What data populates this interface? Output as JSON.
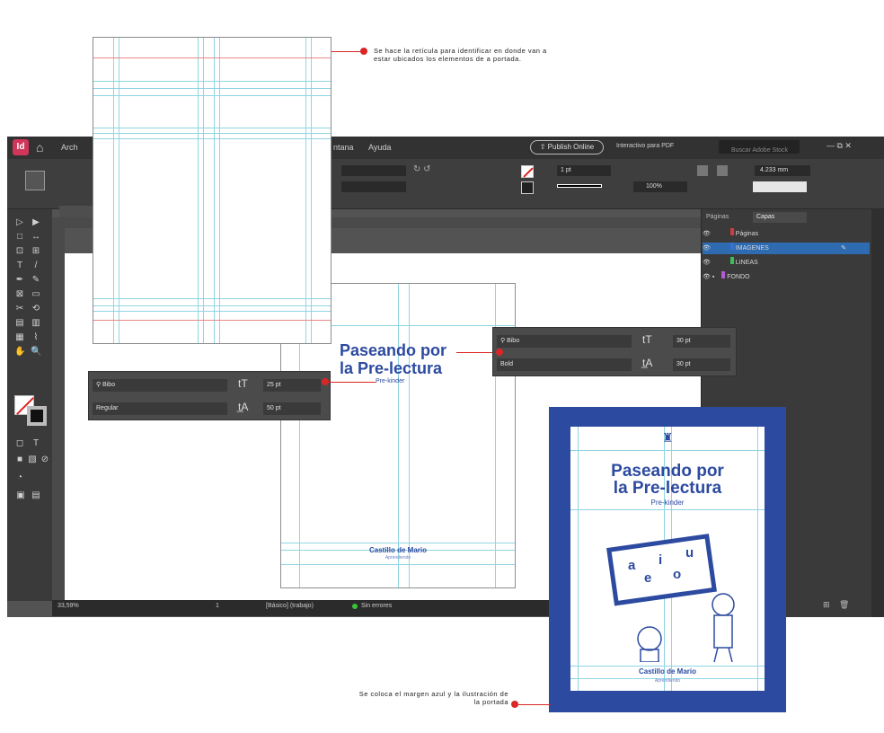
{
  "menubar": {
    "app_logo": "Id",
    "partial_menu_left": "Arch",
    "partial_menu_right": "ntana",
    "help": "Ayuda",
    "share_button": "Publish Online",
    "workspace": "Interactivo para PDF",
    "search_placeholder": "Buscar Adobe Stock"
  },
  "control_bar": {
    "stroke_weight": "1 pt",
    "opacity": "100%",
    "width_value": "4.233 mm"
  },
  "layers_panel": {
    "tabs": [
      "Páginas",
      "Capas"
    ],
    "layers": [
      {
        "name": "Páginas",
        "color": "#d23b3b"
      },
      {
        "name": "IMAGENES",
        "color": "#3b6fd2"
      },
      {
        "name": "LINEAS",
        "color": "#3bbd5a"
      },
      {
        "name": "FONDO",
        "color": "#b25ad2"
      }
    ]
  },
  "status_bar": {
    "zoom": "33,59%",
    "page": "1",
    "style": "[Básico] (trabajo)",
    "preflight": "Sin errores"
  },
  "type_panel_left": {
    "font": "Bibo",
    "style": "Regular",
    "size": "25 pt",
    "leading": "50 pt"
  },
  "type_panel_right": {
    "font": "Bibo",
    "style": "Bold",
    "size": "30 pt",
    "leading": "30 pt"
  },
  "cover": {
    "title_line1": "Paseando por",
    "title_line2": "la Pre-lectura",
    "subtitle": "Pre-kinder",
    "author": "Castillo de Mario",
    "author_sub": "Aprendiendo",
    "vowels": [
      "a",
      "i",
      "u",
      "e",
      "o"
    ]
  },
  "annotations": {
    "top_note": "Se hace la retícula para identificar en donde van a estar ubicados los elementos de a portada.",
    "bottom_note": "Se coloca el margen azul y la ilustración de la portada"
  },
  "colors": {
    "accent_red": "#d92626",
    "cover_blue": "#2c4aa0",
    "guide_cyan": "#8fd5e3"
  }
}
